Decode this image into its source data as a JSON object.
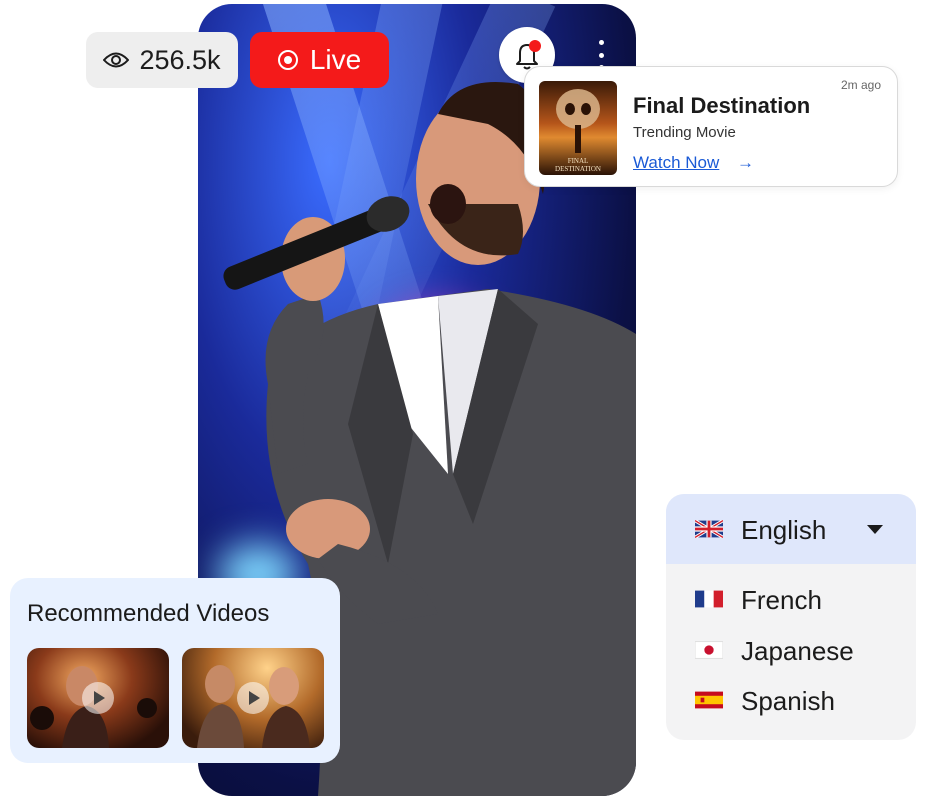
{
  "stream": {
    "viewers": "256.5k",
    "live_label": "Live"
  },
  "notification": {
    "time": "2m ago",
    "title": "Final Destination",
    "subtitle": "Trending Movie",
    "link": "Watch Now",
    "arrow": "→",
    "poster_text": "FINAL DESTINATION"
  },
  "recommended": {
    "title": "Recommended Videos",
    "videos": [
      {
        "icon": "play-icon"
      },
      {
        "icon": "play-icon"
      }
    ]
  },
  "language": {
    "selected": "English",
    "options": [
      "French",
      "Japanese",
      "Spanish"
    ]
  },
  "colors": {
    "live": "#f41a1a",
    "link": "#1a5ad6",
    "rec_bg": "#e8f1ff",
    "lang_head_bg": "#dfe7fb",
    "notif_dot": "#f41a1a"
  }
}
